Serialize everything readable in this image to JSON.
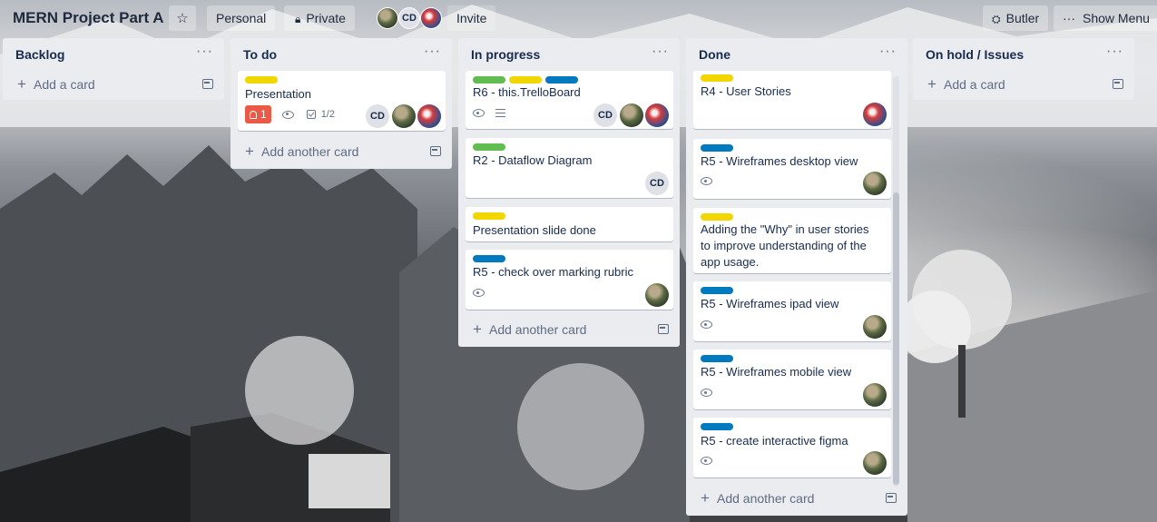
{
  "header": {
    "board_title": "MERN Project Part A",
    "star_icon": "star-icon",
    "team_label": "Personal",
    "visibility_label": "Private",
    "member_initials": "CD",
    "invite_label": "Invite",
    "butler_label": "Butler",
    "show_menu_label": "Show Menu"
  },
  "colors": {
    "label_yellow": "#f2d600",
    "label_green": "#61bd4f",
    "label_blue": "#0079bf",
    "due_red": "#eb5a46",
    "list_bg": "#ebecf0"
  },
  "lists": [
    {
      "title": "Backlog",
      "menu": "···",
      "add_label": "Add a card"
    },
    {
      "title": "To do",
      "menu": "···",
      "add_label": "Add another card"
    },
    {
      "title": "In progress",
      "menu": "···",
      "add_label": "Add another card"
    },
    {
      "title": "Done",
      "menu": "···",
      "add_label": "Add another card"
    },
    {
      "title": "On hold / Issues",
      "menu": "···",
      "add_label": "Add a card"
    }
  ],
  "cards": {
    "todo_presentation": {
      "title": "Presentation",
      "due_count": "1",
      "checklist": "1/2",
      "member": "CD"
    },
    "ip_trelloboard": {
      "title": "R6 - this.TrelloBoard",
      "member": "CD"
    },
    "ip_dataflow": {
      "title": "R2 - Dataflow Diagram",
      "member": "CD"
    },
    "ip_slide": {
      "title": "Presentation slide done"
    },
    "ip_rubric": {
      "title": "R5 - check over marking rubric"
    },
    "done_stories": {
      "title": "R4 - User Stories"
    },
    "done_desktop": {
      "title": "R5 - Wireframes desktop view"
    },
    "done_why": {
      "line1": "Adding the \"Why\" in user stories",
      "line2": "to improve understanding of the",
      "line3": "app usage."
    },
    "done_ipad": {
      "title": "R5 - Wireframes ipad view"
    },
    "done_mobile": {
      "title": "R5 - Wireframes mobile view"
    },
    "done_figma": {
      "title": "R5 - create interactive figma"
    }
  }
}
